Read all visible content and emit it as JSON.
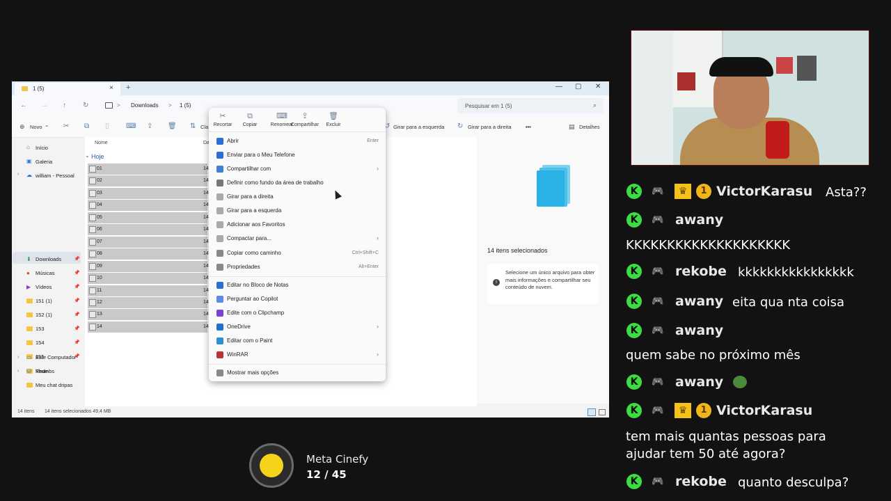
{
  "explorer": {
    "tab_title": "1 (5)",
    "tab_close": "×",
    "add_tab": "+",
    "window_controls": {
      "minimize": "—",
      "maximize": "▢",
      "close": "✕"
    },
    "nav_buttons": {
      "back": "←",
      "forward": "→",
      "up": "↑",
      "refresh": "↻"
    },
    "breadcrumb": {
      "part1": "Downloads",
      "sep": ">",
      "part2": "1 (5)",
      "sep2": ">"
    },
    "search_placeholder": "Pesquisar em 1 (5)",
    "commandbar": {
      "new": "Novo",
      "new_chevron": "⌄",
      "cut_glyph": "✂",
      "classify": "Cla",
      "rotate_left": "Girar para a esquerda",
      "rotate_right": "Girar para a direita",
      "more": "•••",
      "details": "Detalhes"
    },
    "nav_pane": {
      "home": "Início",
      "gallery": "Galeria",
      "onedrive": "william - Pessoal",
      "downloads": "Downloads",
      "music": "Músicas",
      "videos": "Vídeos",
      "f151": "151 (1)",
      "f152": "152 (1)",
      "f153": "153",
      "f154": "154",
      "f155": "155",
      "thumbs": "Thumbs",
      "meu_chat": "Meu chat dripas",
      "this_pc": "Este Computador",
      "network": "Rede"
    },
    "file_list": {
      "col_name": "Nome",
      "col_date": "Da",
      "group": "Hoje",
      "group_chevron": "⌄",
      "date_prefix": "14",
      "files": [
        "01",
        "02",
        "03",
        "04",
        "05",
        "06",
        "07",
        "08",
        "09",
        "10",
        "11",
        "12",
        "13",
        "14"
      ]
    },
    "details_pane": {
      "count": "14 itens selecionados",
      "info": "Selecione um único arquivo para obter mais informações e compartilhar seu conteúdo de nuvem.",
      "info_icon": "i"
    },
    "status": {
      "items": "14 itens",
      "selected": "14 itens selecionados 49,4 MB"
    }
  },
  "context_menu": {
    "quick_actions": [
      {
        "label": "Recortar",
        "icon": "✂"
      },
      {
        "label": "Copiar",
        "icon": "⧉"
      },
      {
        "label": "Renomear",
        "icon": "⌨"
      },
      {
        "label": "Compartilhar",
        "icon": "⇪"
      },
      {
        "label": "Excluir",
        "icon": "🗑"
      }
    ],
    "items": [
      {
        "label": "Abrir",
        "shortcut": "Enter"
      },
      {
        "label": "Enviar para o Meu Telefone"
      },
      {
        "label": "Compartilhar com",
        "arrow": "›"
      },
      {
        "label": "Definir como fundo da área de trabalho"
      },
      {
        "label": "Girar para a direita"
      },
      {
        "label": "Girar para a esquerda"
      },
      {
        "label": "Adicionar aos Favoritos"
      },
      {
        "label": "Compactar para...",
        "arrow": "›"
      },
      {
        "label": "Copiar como caminho",
        "shortcut": "Ctrl+Shift+C"
      },
      {
        "label": "Propriedades",
        "shortcut": "Alt+Enter"
      },
      {
        "label": "Editar no Bloco de Notas"
      },
      {
        "label": "Perguntar ao Copilot"
      },
      {
        "label": "Edite com o Clipchamp"
      },
      {
        "label": "OneDrive",
        "arrow": "›"
      },
      {
        "label": "Editar com o Paint"
      },
      {
        "label": "WinRAR",
        "arrow": "›"
      },
      {
        "label": "Mostrar mais opções"
      }
    ]
  },
  "chat": {
    "badges": {
      "k": "K",
      "sub": "1"
    },
    "messages": [
      {
        "user": "VictorKarasu",
        "text": "Asta??"
      },
      {
        "user": "awany",
        "text": "KKKKKKKKKKKKKKKKKKKK"
      },
      {
        "user": "rekobe",
        "text": "kkkkkkkkkkkkkkkk"
      },
      {
        "user": "awany",
        "text": "eita qua nta coisa"
      },
      {
        "user": "awany",
        "text": "quem sabe no próximo mês"
      },
      {
        "user": "awany",
        "text": ""
      },
      {
        "user": "VictorKarasu",
        "text": "tem mais quantas pessoas para"
      },
      {
        "user": "",
        "text": "ajudar tem 50 até agora?"
      },
      {
        "user": "rekobe",
        "text": "quanto desculpa?"
      }
    ]
  },
  "goal": {
    "title": "Meta Cinefy",
    "progress": "12 / 45",
    "current": 12,
    "target": 45
  },
  "colors": {
    "background": "#121212",
    "kick_green": "#3ddc43",
    "sub_gold": "#f5c21b",
    "selection_gray": "#c9c9c9"
  }
}
